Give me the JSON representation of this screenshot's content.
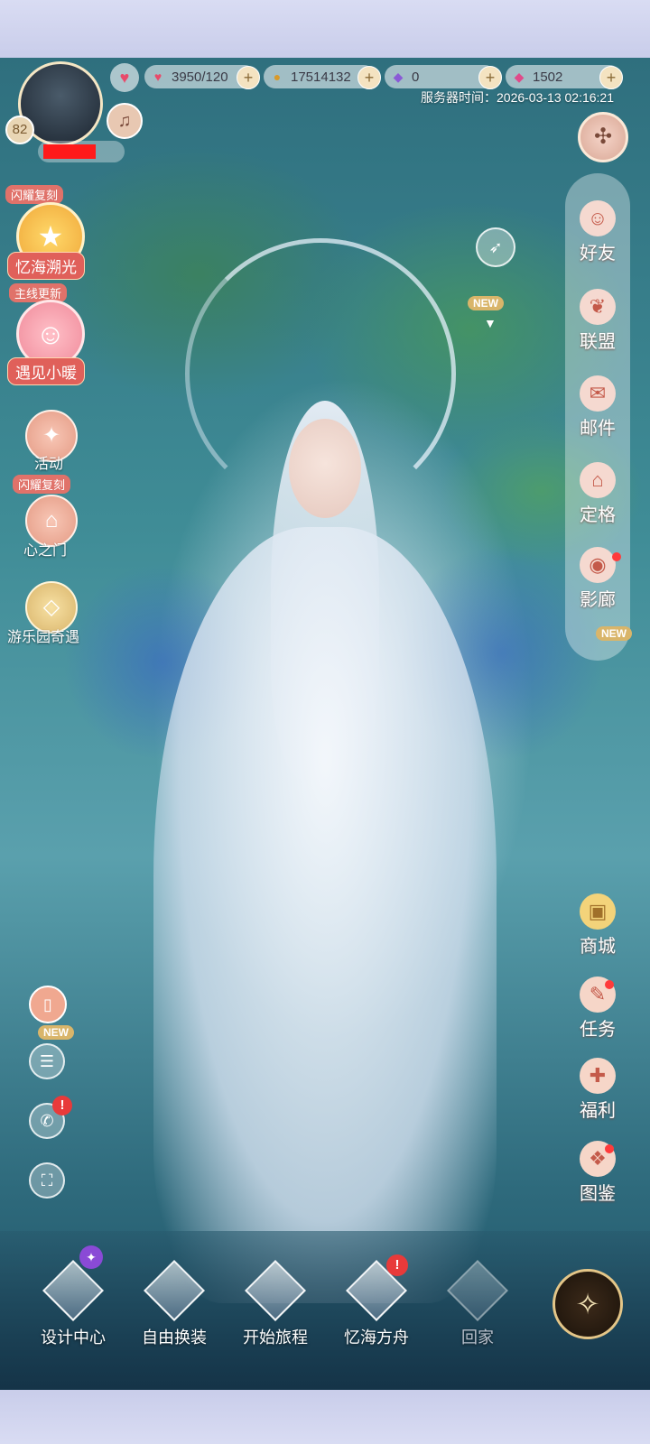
{
  "hud": {
    "level": "82",
    "stamina": "3950/120",
    "gold": "17514132",
    "crystal_purple": "0",
    "diamond_pink": "1502",
    "server_time_label": "服务器时间：",
    "server_time": "2026-03-13 02:16:21",
    "icons": {
      "heart": "heart-icon",
      "gold": "cat-coin-icon",
      "purple": "purple-gem-icon",
      "pink": "pink-diamond-icon",
      "music": "music-note-icon",
      "compass": "pinwheel-icon"
    }
  },
  "left_events": {
    "event1_tag": "闪耀复刻",
    "event1_label": "忆海溯光",
    "event2_tag": "主线更新",
    "event2_label": "遇见小暖",
    "activity": "活动",
    "event3_tag": "闪耀复刻",
    "heart_gate": "心之门",
    "park": "游乐园奇遇"
  },
  "right_menu": {
    "friends": "好友",
    "alliance": "联盟",
    "mail": "邮件",
    "pose": "定格",
    "gallery": "影廊",
    "new_badge": "NEW",
    "shop": "商城",
    "tasks": "任务",
    "benefits": "福利",
    "codex": "图鉴"
  },
  "floating": {
    "new_badge": "NEW"
  },
  "left_utils": {
    "new_badge": "NEW",
    "alert": "!"
  },
  "bottom_nav": {
    "design": "设计中心",
    "free_dress": "自由换装",
    "journey": "开始旅程",
    "ark": "忆海方舟",
    "home": "回家",
    "alert": "!"
  },
  "colors": {
    "accent_red": "#e0605a",
    "badge_gold": "#d9b56a",
    "alert_red": "#e83a3a"
  }
}
